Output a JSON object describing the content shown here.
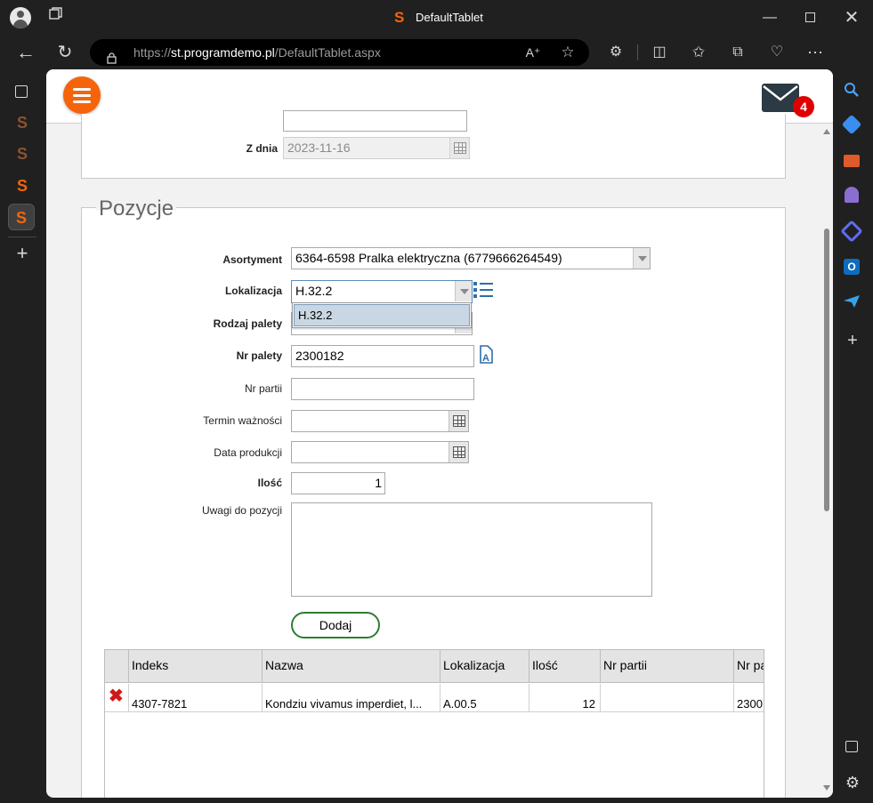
{
  "browser": {
    "tab_title": "DefaultTablet",
    "url_prefix": "https://",
    "url_host": "st.programdemo.pl",
    "url_path": "/DefaultTablet.aspx"
  },
  "header": {
    "mail_count": "4"
  },
  "top_section": {
    "z_dnia_label": "Z dnia",
    "z_dnia_value": "2023-11-16"
  },
  "pozycje": {
    "legend": "Pozycje",
    "asortyment_label": "Asortyment",
    "asortyment_value": "6364-6598 Pralka elektryczna (6779666264549)",
    "lokalizacja_label": "Lokalizacja",
    "lokalizacja_value": "H.32.2",
    "lokalizacja_options": [
      "H.32.2"
    ],
    "rodzaj_palety_label": "Rodzaj palety",
    "nr_palety_label": "Nr palety",
    "nr_palety_value": "2300182",
    "nr_partii_label": "Nr partii",
    "nr_partii_value": "",
    "termin_label": "Termin ważności",
    "termin_value": "",
    "data_produkcji_label": "Data produkcji",
    "data_produkcji_value": "",
    "ilosc_label": "Ilość",
    "ilosc_value": "1",
    "uwagi_label": "Uwagi do pozycji",
    "uwagi_value": "",
    "dodaj_label": "Dodaj"
  },
  "grid": {
    "columns": [
      "Indeks",
      "Nazwa",
      "Lokalizacja",
      "Ilość",
      "Nr partii",
      "Nr pa"
    ],
    "rows": [
      {
        "indeks": "4307-7821",
        "nazwa": "Kondziu vivamus imperdiet, l...",
        "lokalizacja": "A.00.5",
        "ilosc": "12",
        "nr_partii": "",
        "nr_palety": "2300"
      }
    ]
  },
  "colors": {
    "accent_orange": "#f5640a",
    "badge_red": "#e00000",
    "button_green": "#2f7d32"
  }
}
